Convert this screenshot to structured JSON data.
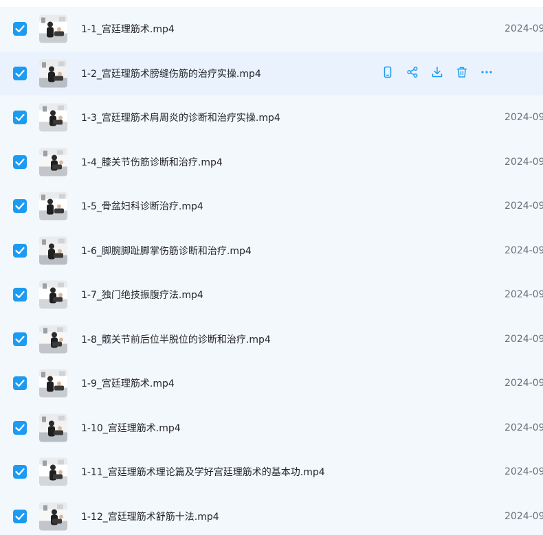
{
  "colors": {
    "accent": "#1c9bf2",
    "list_background": "#f3f8fd",
    "hover_background": "#eaf3fd",
    "text": "#25262b",
    "muted_text": "#6b6f76"
  },
  "hover_actions": [
    {
      "icon": "phone-icon"
    },
    {
      "icon": "share-icon"
    },
    {
      "icon": "download-icon"
    },
    {
      "icon": "trash-icon"
    },
    {
      "icon": "more-icon"
    }
  ],
  "files": [
    {
      "name": "1-1_宫廷理筋术.mp4",
      "date": "2024-09",
      "checked": true,
      "hovered": false
    },
    {
      "name": "1-2_宫廷理筋术膀缝伤筋的治疗实操.mp4",
      "date": "",
      "checked": true,
      "hovered": true
    },
    {
      "name": "1-3_宫廷理筋术肩周炎的诊断和治疗实操.mp4",
      "date": "2024-09",
      "checked": true,
      "hovered": false
    },
    {
      "name": "1-4_膝关节伤筋诊断和治疗.mp4",
      "date": "2024-09",
      "checked": true,
      "hovered": false
    },
    {
      "name": "1-5_骨盆妇科诊断治疗.mp4",
      "date": "2024-09",
      "checked": true,
      "hovered": false
    },
    {
      "name": "1-6_脚腕脚趾脚掌伤筋诊断和治疗.mp4",
      "date": "2024-09",
      "checked": true,
      "hovered": false
    },
    {
      "name": "1-7_独门绝技振腹疗法.mp4",
      "date": "2024-09",
      "checked": true,
      "hovered": false
    },
    {
      "name": "1-8_髋关节前后位半脱位的诊断和治疗.mp4",
      "date": "2024-09",
      "checked": true,
      "hovered": false
    },
    {
      "name": "1-9_宫廷理筋术.mp4",
      "date": "2024-09",
      "checked": true,
      "hovered": false
    },
    {
      "name": "1-10_宫廷理筋术.mp4",
      "date": "2024-09",
      "checked": true,
      "hovered": false
    },
    {
      "name": "1-11_宫廷理筋术理论篇及学好宫廷理筋术的基本功.mp4",
      "date": "2024-09",
      "checked": true,
      "hovered": false
    },
    {
      "name": "1-12_宫廷理筋术舒筋十法.mp4",
      "date": "2024-09",
      "checked": true,
      "hovered": false
    }
  ]
}
